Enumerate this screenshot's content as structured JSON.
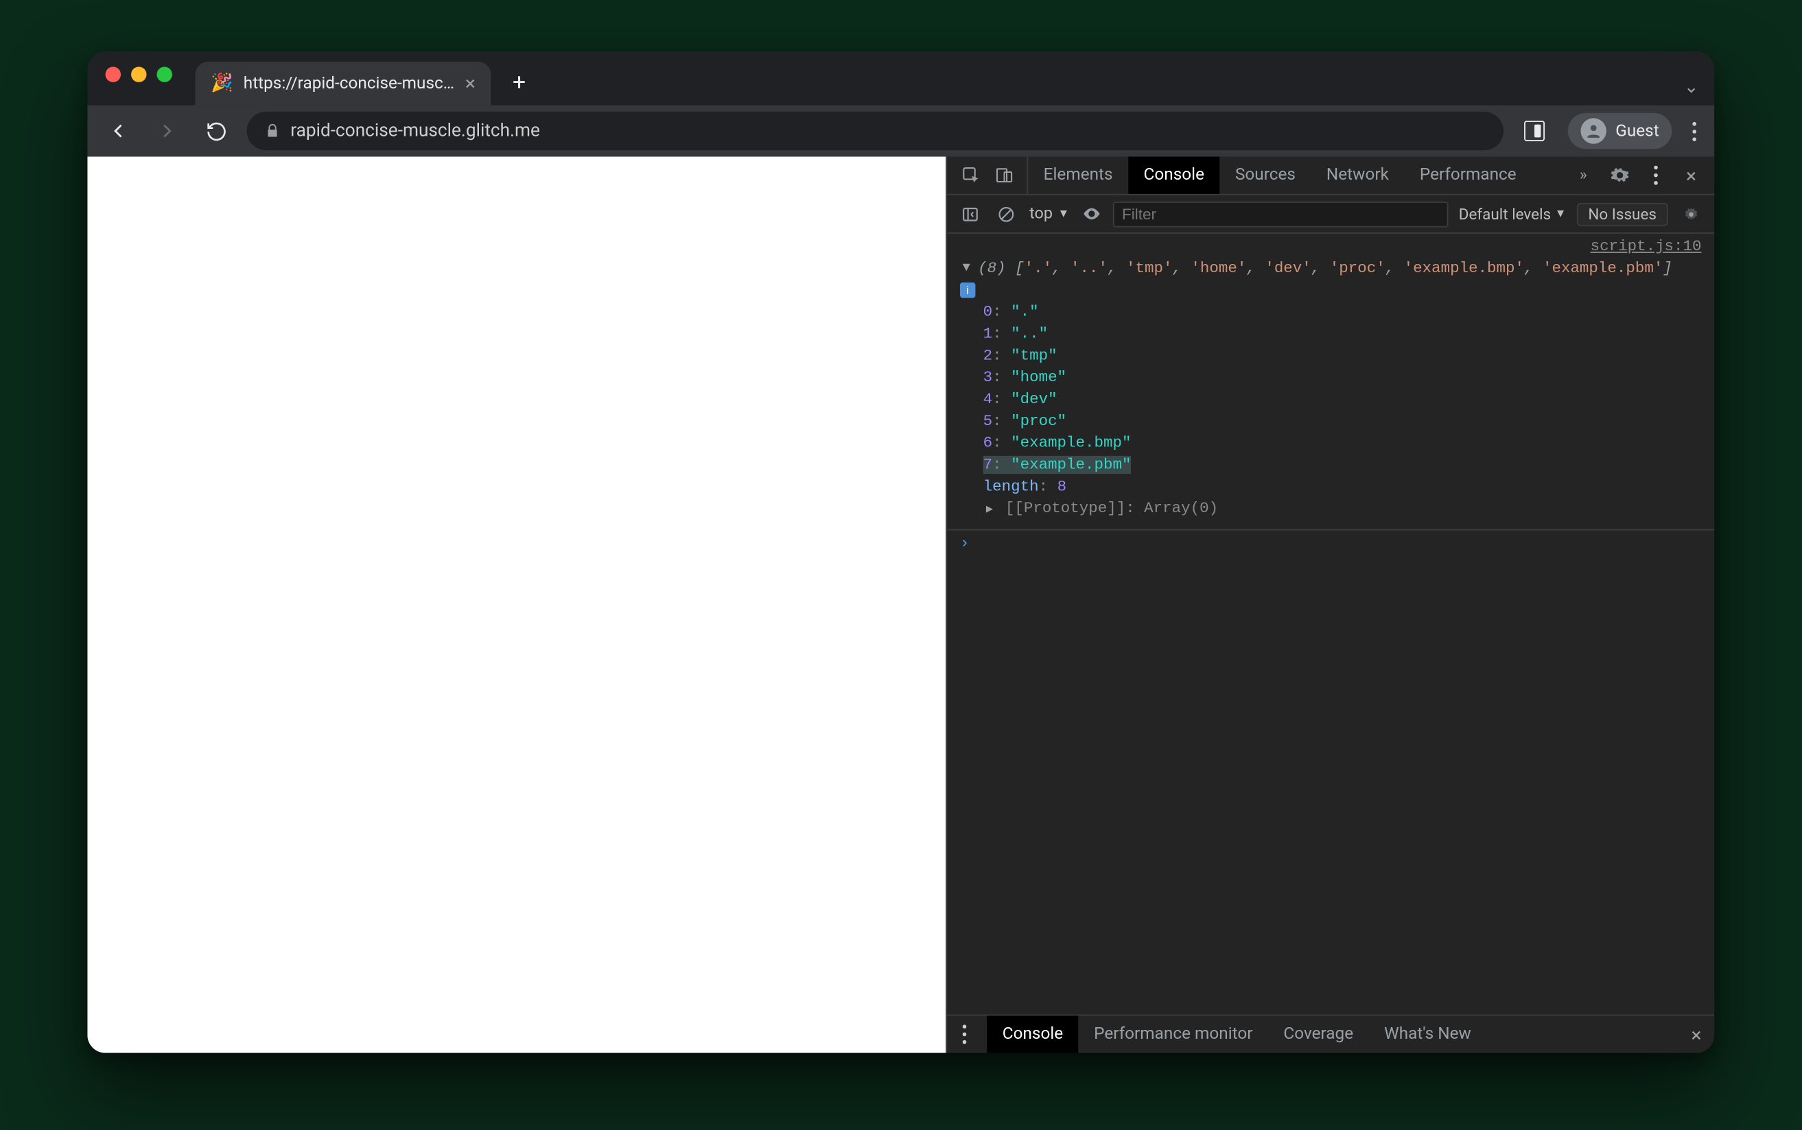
{
  "window": {
    "tab_favicon": "🎉",
    "tab_title": "https://rapid-concise-muscle.g",
    "url_display": "rapid-concise-muscle.glitch.me",
    "guest_label": "Guest"
  },
  "devtools": {
    "tabs": [
      "Elements",
      "Console",
      "Sources",
      "Network",
      "Performance"
    ],
    "active_tab": "Console",
    "console_bar": {
      "context": "top",
      "filter_placeholder": "Filter",
      "levels": "Default levels",
      "issues": "No Issues"
    },
    "source_link": "script.js:10",
    "array": {
      "length_display": "(8)",
      "preview": [
        "'.'",
        "'..'",
        "'tmp'",
        "'home'",
        "'dev'",
        "'proc'",
        "'example.bmp'",
        "'example.pbm'"
      ],
      "items": [
        {
          "index": "0",
          "value": "\".\""
        },
        {
          "index": "1",
          "value": "\"..\""
        },
        {
          "index": "2",
          "value": "\"tmp\""
        },
        {
          "index": "3",
          "value": "\"home\""
        },
        {
          "index": "4",
          "value": "\"dev\""
        },
        {
          "index": "5",
          "value": "\"proc\""
        },
        {
          "index": "6",
          "value": "\"example.bmp\""
        },
        {
          "index": "7",
          "value": "\"example.pbm\"",
          "highlight": true
        }
      ],
      "length_label": "length",
      "length_value": "8",
      "prototype_label": "[[Prototype]]",
      "prototype_value": "Array(0)"
    },
    "drawer": {
      "tabs": [
        "Console",
        "Performance monitor",
        "Coverage",
        "What's New"
      ],
      "active": "Console"
    }
  }
}
